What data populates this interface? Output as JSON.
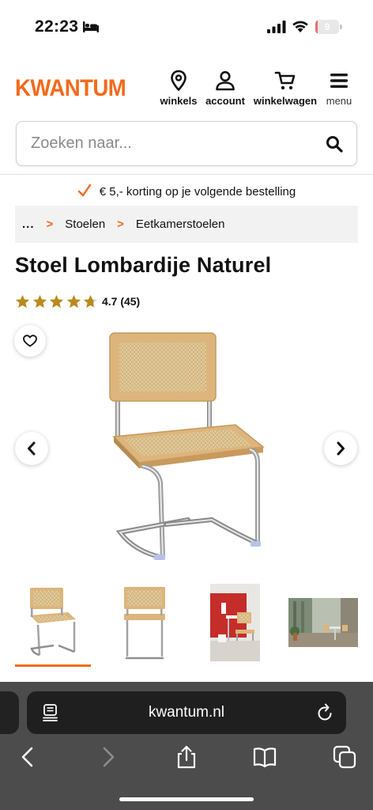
{
  "status_bar": {
    "time": "22:23",
    "battery_level": "9",
    "battery_fraction": 0.09
  },
  "header": {
    "logo": "KWANTUM",
    "nav": [
      {
        "label": "winkels",
        "icon": "location-pin-icon"
      },
      {
        "label": "account",
        "icon": "user-icon"
      },
      {
        "label": "winkelwagen",
        "icon": "cart-icon"
      },
      {
        "label": "menu",
        "icon": "hamburger-menu-icon"
      }
    ]
  },
  "search": {
    "placeholder": "Zoeken naar...",
    "value": ""
  },
  "promo": {
    "text": "€ 5,- korting op je volgende bestelling"
  },
  "breadcrumb": {
    "root": "...",
    "items": [
      "Stoelen",
      "Eetkamerstoelen"
    ]
  },
  "product": {
    "title": "Stoel Lombardije Naturel",
    "rating_value": 4.7,
    "rating_text": "4.7 (45)",
    "rating_max": 5
  },
  "gallery": {
    "thumbnail_count": 4,
    "active_index": 0
  },
  "browser": {
    "url": "kwantum.nl"
  },
  "colors": {
    "brand": "#f26a1b",
    "star": "#b98a1c",
    "toolbar_bg": "#4c4c4c"
  }
}
